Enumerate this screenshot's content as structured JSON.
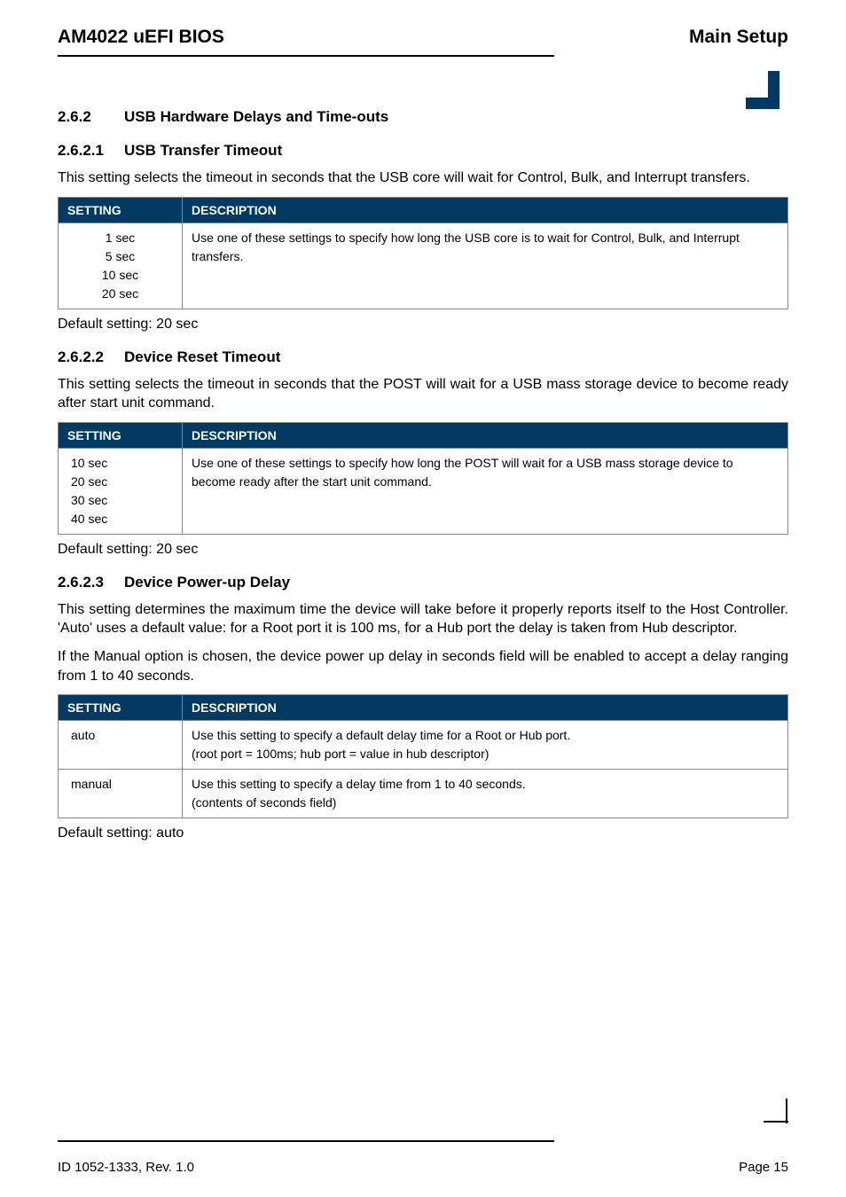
{
  "header": {
    "left": "AM4022 uEFI BIOS",
    "right": "Main Setup"
  },
  "section262": {
    "number": "2.6.2",
    "title": "USB Hardware Delays and Time-outs"
  },
  "section2621": {
    "number": "2.6.2.1",
    "title": "USB Transfer Timeout",
    "intro": "This setting selects the timeout in seconds that the USB core will wait for Control, Bulk, and Interrupt transfers.",
    "table": {
      "headerSetting": "SETTING",
      "headerDescription": "DESCRIPTION",
      "settingLines": "1 sec\n5 sec\n10 sec\n20 sec",
      "description": "Use one of these settings to specify how long the USB core is to wait for Control, Bulk, and Interrupt transfers."
    },
    "default": "Default setting: 20 sec"
  },
  "section2622": {
    "number": "2.6.2.2",
    "title": "Device Reset Timeout",
    "intro": "This setting selects the timeout in seconds that the POST will wait for a USB mass storage device to become ready after start unit command.",
    "table": {
      "headerSetting": "SETTING",
      "headerDescription": "DESCRIPTION",
      "settingLines": "10 sec\n20 sec\n30 sec\n40 sec",
      "description": "Use one of these settings to specify how long the POST will wait for a USB mass storage device to become ready after the start unit command."
    },
    "default": "Default setting: 20 sec"
  },
  "section2623": {
    "number": "2.6.2.3",
    "title": "Device Power-up Delay",
    "intro1": "This setting determines the maximum time the device will take before it properly reports itself to the Host Controller. 'Auto' uses a default value: for a Root port it is 100 ms, for a Hub port the delay is taken from Hub descriptor.",
    "intro2": "If the Manual option is chosen, the device power up delay in seconds field will be enabled to accept a delay ranging from 1 to 40 seconds.",
    "table": {
      "headerSetting": "SETTING",
      "headerDescription": "DESCRIPTION",
      "row1Setting": "auto",
      "row1Desc": "Use this setting to specify a default delay time for a Root or Hub port.\n(root port = 100ms; hub port = value in hub descriptor)",
      "row2Setting": "manual",
      "row2Desc": "Use this setting to specify a delay time from 1 to 40 seconds.\n(contents of seconds field)"
    },
    "default": "Default setting: auto"
  },
  "footer": {
    "left": "ID 1052-1333, Rev. 1.0",
    "right": "Page 15"
  }
}
